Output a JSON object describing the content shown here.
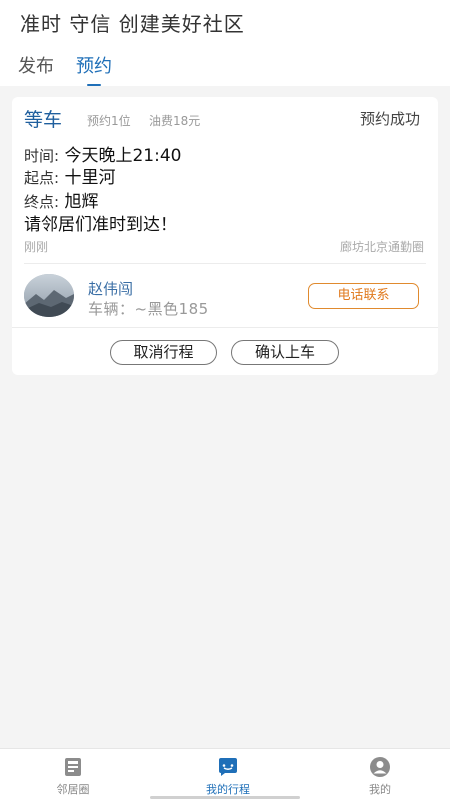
{
  "header": {
    "slogan": "准时 守信 创建美好社区",
    "tabs": [
      {
        "label": "发布",
        "active": false
      },
      {
        "label": "预约",
        "active": true
      }
    ]
  },
  "booking": {
    "mode": "等车",
    "seats": "预约1位",
    "fee": "油费18元",
    "status": "预约成功",
    "time_label": "时间:",
    "time_value": "今天晚上21:40",
    "start_label": "起点:",
    "start_value": "十里河",
    "end_label": "终点:",
    "end_value": "旭辉",
    "note": "请邻居们准时到达！",
    "posted": "刚刚",
    "circle": "廊坊北京通勤圈"
  },
  "driver": {
    "name": "赵伟闯",
    "vehicle": "车辆：~黑色185",
    "call_label": "电话联系"
  },
  "actions": {
    "cancel_label": "取消行程",
    "confirm_label": "确认上车"
  },
  "bottom_nav": [
    {
      "label": "邻居圈",
      "icon": "community-icon",
      "active": false
    },
    {
      "label": "我的行程",
      "icon": "trips-icon",
      "active": true
    },
    {
      "label": "我的",
      "icon": "profile-icon",
      "active": false
    }
  ],
  "colors": {
    "accent": "#1f6fb8",
    "call_orange": "#e07a1e",
    "background": "#f4f4f4"
  }
}
